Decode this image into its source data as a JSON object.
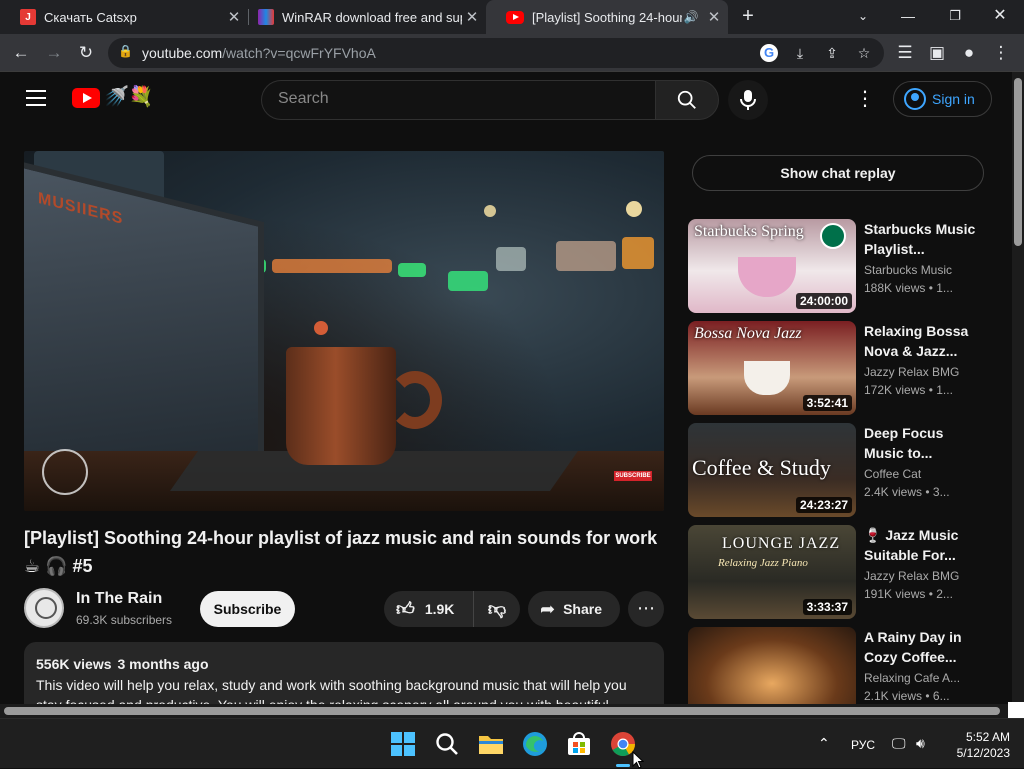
{
  "browser": {
    "tabs": [
      {
        "title": "Скачать Catsxp",
        "favicon": "catsxp-icon",
        "active": false
      },
      {
        "title": "WinRAR download free and supp",
        "favicon": "winrar-icon",
        "active": false
      },
      {
        "title": "[Playlist] Soothing 24-hour p",
        "favicon": "youtube-icon",
        "active": true
      }
    ],
    "url_host": "youtube.com",
    "url_path": "/watch?v=qcwFrYFVhoA"
  },
  "yt": {
    "search_placeholder": "Search",
    "sign_in": "Sign in"
  },
  "video": {
    "title": "[Playlist] Soothing 24-hour playlist of jazz music and rain sounds for work ☕ 🎧 #5",
    "overlay_badge": "SUBSCRIBE",
    "channel": "In The Rain",
    "subscribers": "69.3K subscribers",
    "subscribe_label": "Subscribe",
    "likes": "1.9K",
    "share_label": "Share",
    "views": "556K views",
    "age": "3 months ago",
    "description": "This video will help you relax, study and work with soothing background music that will help you stay focused and productive. You will enjoy the relaxing scenery all around you with beautiful"
  },
  "sidebar": {
    "chat_replay": "Show chat replay",
    "recommendations": [
      {
        "title": "Starbucks Music Playlist...",
        "channel": "Starbucks Music",
        "views": "188K views",
        "age": "• 1...",
        "duration": "24:00:00",
        "thumb_text": "Starbucks Spring",
        "thumb_color": "#d8c7c9"
      },
      {
        "title": "Relaxing Bossa Nova & Jazz...",
        "channel": "Jazzy Relax BMG",
        "views": "172K views",
        "age": "• 1...",
        "duration": "3:52:41",
        "thumb_text": "Bossa Nova Jazz",
        "thumb_color": "#8a2a2a"
      },
      {
        "title": "Deep Focus Music to...",
        "channel": "Coffee Cat",
        "views": "2.4K views",
        "age": "• 3...",
        "duration": "24:23:27",
        "thumb_text": "Coffee & Study",
        "thumb_color": "#2a2320"
      },
      {
        "title": "🍷 Jazz Music Suitable For...",
        "channel": "Jazzy Relax BMG",
        "views": "191K views",
        "age": "• 2...",
        "duration": "3:33:37",
        "thumb_text": "LOUNGE JAZZ",
        "thumb_color": "#3d3a2c"
      },
      {
        "title": "A Rainy Day in Cozy Coffee...",
        "channel": "Relaxing Cafe A...",
        "views": "2.1K views",
        "age": "• 6...",
        "duration": "",
        "thumb_text": "",
        "thumb_color": "#4a2a18"
      }
    ]
  },
  "taskbar": {
    "language": "РУС",
    "time": "5:52 AM",
    "date": "5/12/2023"
  }
}
